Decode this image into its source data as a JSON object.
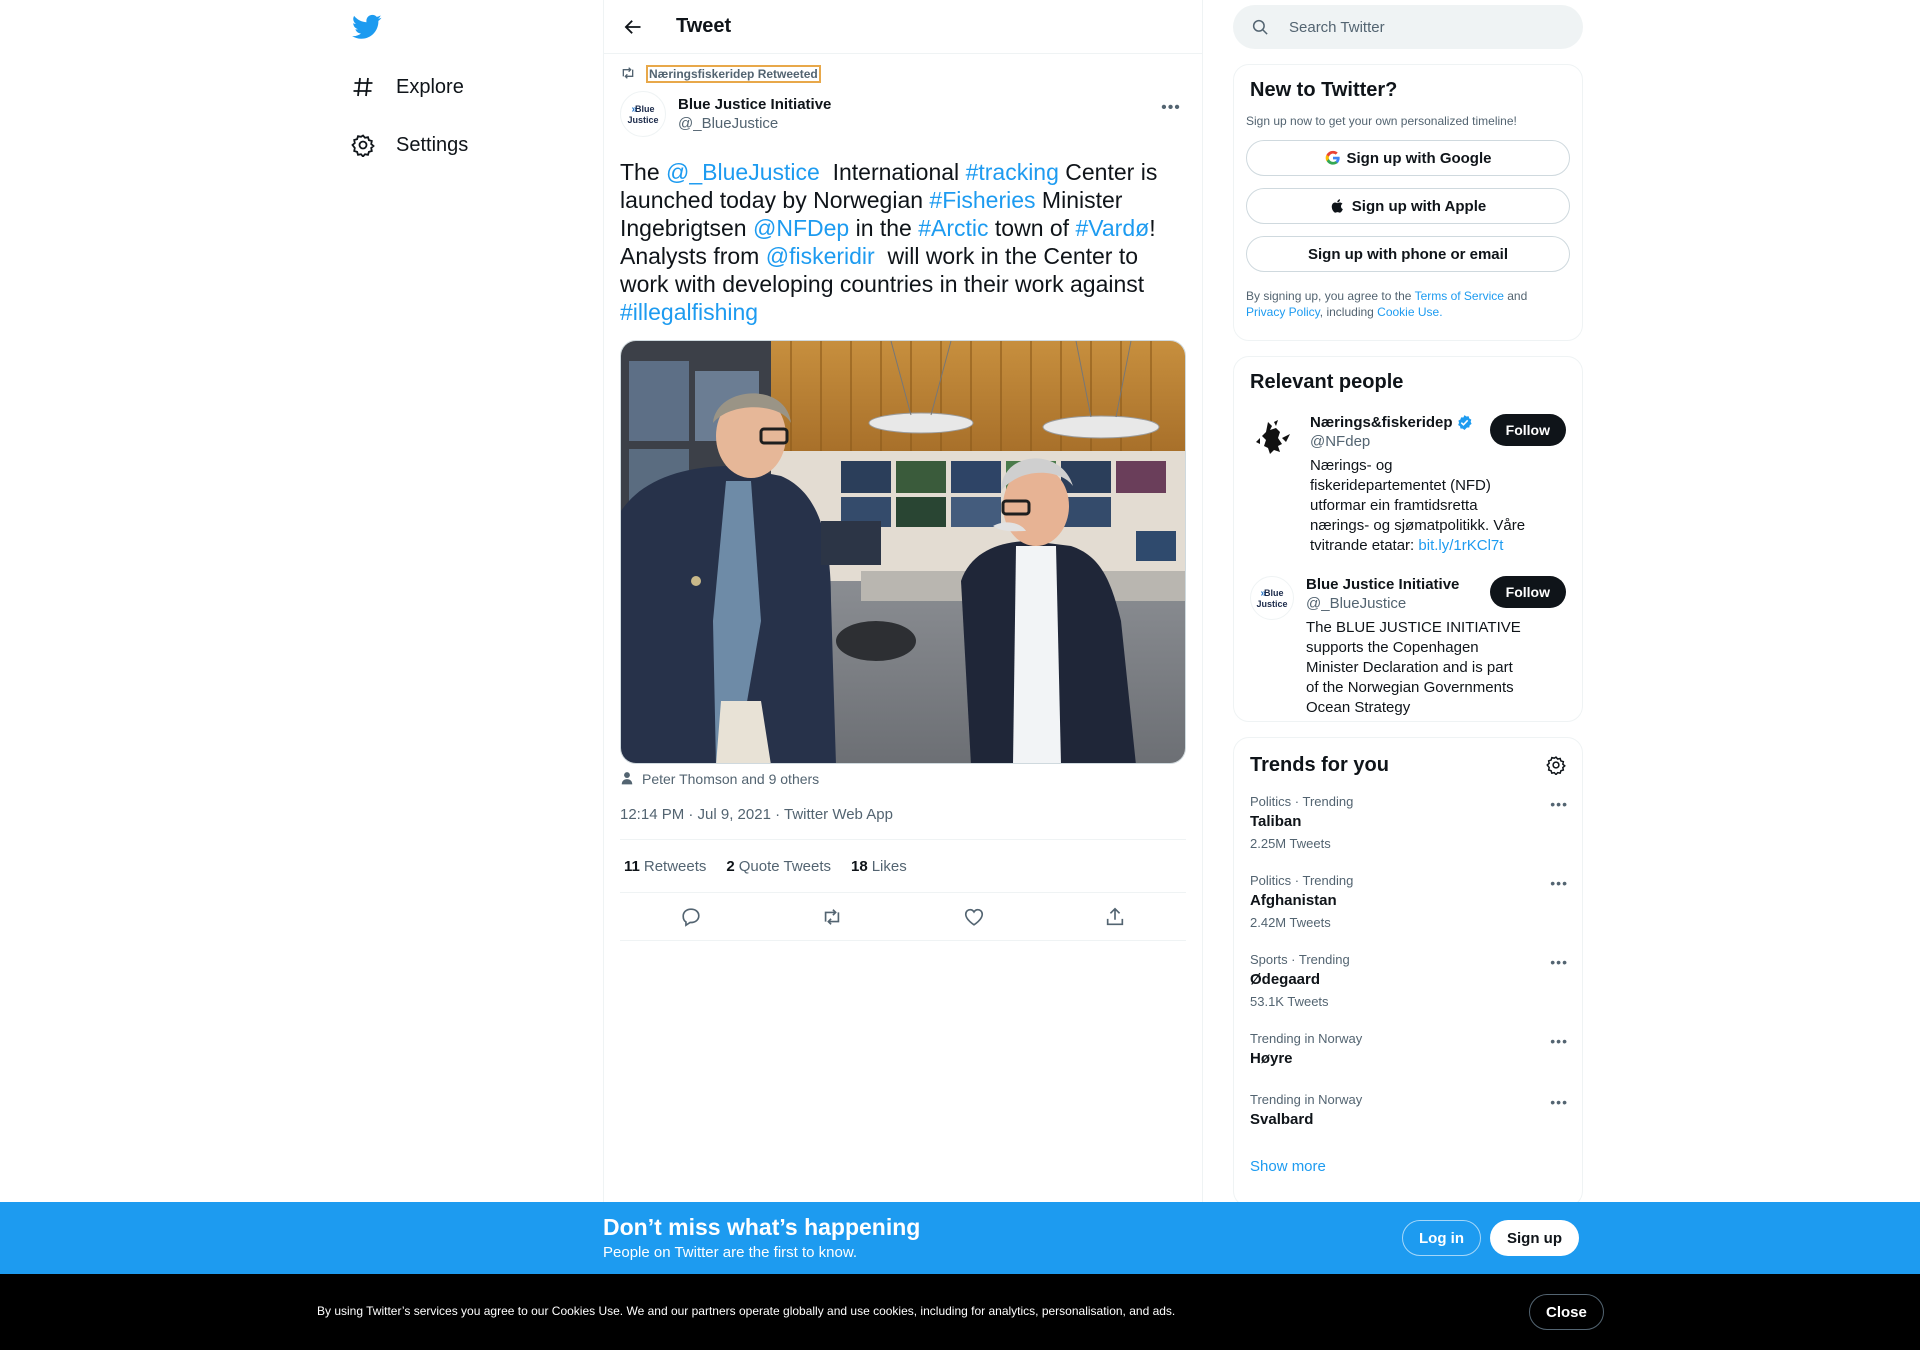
{
  "nav": {
    "logo_icon": "twitter-bird-icon",
    "items": [
      {
        "label": "Explore",
        "icon": "hashtag-icon"
      },
      {
        "label": "Settings",
        "icon": "gear-icon"
      }
    ]
  },
  "header": {
    "title": "Tweet",
    "back_icon": "back-arrow-icon"
  },
  "tweet": {
    "retweeted_by": "Næringsfiskeridep Retweeted",
    "author": {
      "name": "Blue Justice Initiative",
      "handle": "@_BlueJustice",
      "avatar_line1": "Blue",
      "avatar_line2": "Justice"
    },
    "text_parts": [
      {
        "t": "The ",
        "link": false
      },
      {
        "t": "@_BlueJustice",
        "link": true
      },
      {
        "t": "  International ",
        "link": false
      },
      {
        "t": "#tracking",
        "link": true
      },
      {
        "t": " Center is launched today by Norwegian ",
        "link": false
      },
      {
        "t": "#Fisheries",
        "link": true
      },
      {
        "t": " Minister Ingebrigtsen ",
        "link": false
      },
      {
        "t": "@NFDep",
        "link": true
      },
      {
        "t": " in the ",
        "link": false
      },
      {
        "t": "#Arctic",
        "link": true
      },
      {
        "t": " town of ",
        "link": false
      },
      {
        "t": "#Vardø",
        "link": true
      },
      {
        "t": "! Analysts from ",
        "link": false
      },
      {
        "t": "@fiskeridir",
        "link": true
      },
      {
        "t": "  will work in the Center to work with developing countries in their work against ",
        "link": false
      },
      {
        "t": "#illegalfishing",
        "link": true
      }
    ],
    "tagged": "Peter Thomson and 9 others",
    "timestamp": "12:14 PM · Jul 9, 2021 · Twitter Web App",
    "stats": {
      "retweets_count": "11",
      "retweets_label": "Retweets",
      "quotes_count": "2",
      "quotes_label": "Quote Tweets",
      "likes_count": "18",
      "likes_label": "Likes"
    }
  },
  "sidebar": {
    "search_placeholder": "Search Twitter",
    "new_to_twitter": {
      "title": "New to Twitter?",
      "subtitle": "Sign up now to get your own personalized timeline!",
      "google": "Sign up with Google",
      "apple": "Sign up with Apple",
      "phone": "Sign up with phone or email",
      "terms_1": "By signing up, you agree to the ",
      "terms_link1": "Terms of Service",
      "terms_2": " and ",
      "terms_link2": "Privacy Policy",
      "terms_3": ", including ",
      "terms_link3": "Cookie Use."
    },
    "relevant_people": {
      "title": "Relevant people",
      "people": [
        {
          "name": "Nærings&fiskeridep",
          "handle": "@NFdep",
          "verified": true,
          "bio": "Nærings- og fiskeridepartementet (NFD) utformar ein framtidsretta nærings- og sjømatpolitikk. Våre tvitrande etatar: ",
          "bio_link": "bit.ly/1rKCl7t",
          "follow": "Follow"
        },
        {
          "name": "Blue Justice Initiative",
          "handle": "@_BlueJustice",
          "verified": false,
          "bio": "The BLUE JUSTICE INITIATIVE supports the Copenhagen Minister Declaration and is part of the Norwegian Governments Ocean Strategy",
          "follow": "Follow"
        }
      ]
    },
    "trends": {
      "title": "Trends for you",
      "items": [
        {
          "category": "Politics · Trending",
          "name": "Taliban",
          "count": "2.25M Tweets"
        },
        {
          "category": "Politics · Trending",
          "name": "Afghanistan",
          "count": "2.42M Tweets"
        },
        {
          "category": "Sports · Trending",
          "name": "Ødegaard",
          "count": "53.1K Tweets"
        },
        {
          "category": "Trending in Norway",
          "name": "Høyre",
          "count": ""
        },
        {
          "category": "Trending in Norway",
          "name": "Svalbard",
          "count": ""
        }
      ],
      "show_more": "Show more"
    }
  },
  "bottom_bar": {
    "headline": "Don’t miss what’s happening",
    "subline": "People on Twitter are the first to know.",
    "login": "Log in",
    "signup": "Sign up"
  },
  "cookie_bar": {
    "text": "By using Twitter’s services you agree to our Cookies Use. We and our partners operate globally and use cookies, including for analytics, personalisation, and ads.",
    "close": "Close"
  },
  "colors": {
    "accent": "#1d9bf0",
    "text": "#0f1419",
    "secondary": "#536471",
    "cookie_bg": "#000000"
  }
}
